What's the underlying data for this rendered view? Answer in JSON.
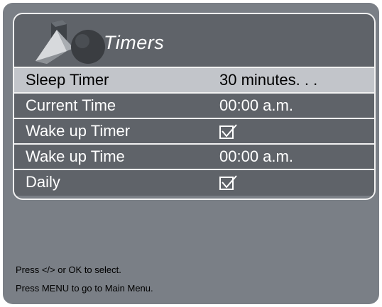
{
  "menu": {
    "title": "Timers",
    "logo_icon": "shapes-logo-icon",
    "rows": [
      {
        "label": "Sleep Timer",
        "value": "30 minutes. . .",
        "selected": true
      },
      {
        "label": "Current Time",
        "value": "00:00 a.m."
      },
      {
        "label": "Wake up Timer",
        "checked": true,
        "icon": "checkbox-checked-icon"
      },
      {
        "label": "Wake up Time",
        "value": "00:00 a.m."
      },
      {
        "label": "Daily",
        "checked": true,
        "icon": "checkbox-checked-icon"
      }
    ]
  },
  "help": {
    "line1": "Press </> or OK to select.",
    "line2": "Press MENU to go to Main Menu."
  },
  "colors": {
    "panel_bg": "#7a7f86",
    "row_bg": "#5f6369",
    "selected_row_bg": "#c2c5ca",
    "border": "#f2f2f2"
  }
}
